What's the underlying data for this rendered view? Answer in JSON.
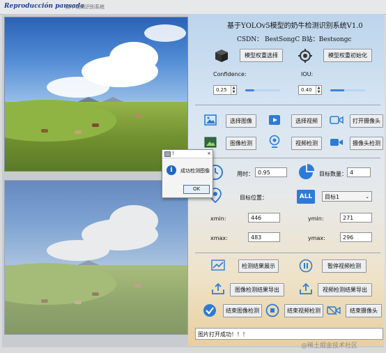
{
  "window": {
    "title_overlay": "Reproducción pausada",
    "app_name": "奶牛检测识别系统"
  },
  "header": {
    "title": "基于YOLOv5模型的奶牛检测识别系统V1.0",
    "subtitle": "CSDN：  BestSongC   B站：Bestsongc"
  },
  "model": {
    "select_label": "模型权重选择",
    "init_label": "模型权重初始化",
    "confidence_label": "Confidence:",
    "confidence_value": "0.25",
    "confidence_level": 0.25,
    "iou_label": "IOU:",
    "iou_value": "0.40",
    "iou_level": 0.4
  },
  "actions": {
    "select_image": "选择图像",
    "select_video": "选择视频",
    "open_camera": "打开摄像头",
    "image_detect": "图像检测",
    "video_detect": "视频检测",
    "camera_detect": "摄像头检测"
  },
  "results": {
    "time_label": "用时：",
    "time_value": "0.95",
    "count_label": "目标数量：",
    "count_value": "4",
    "position_label": "目标位置：",
    "target_select": "目标1",
    "xmin_label": "xmin:",
    "xmin_value": "446",
    "ymin_label": "ymin:",
    "ymin_value": "271",
    "xmax_label": "xmax:",
    "xmax_value": "483",
    "ymax_label": "ymax:",
    "ymax_value": "296"
  },
  "bottom_actions": {
    "show_results": "检测结果展示",
    "pause_video": "暂停视频检测",
    "export_image": "图像检测结果导出",
    "export_video": "视频检测结果导出",
    "end_image": "结束图像检测",
    "end_video": "结束视频检测",
    "end_camera": "结束摄像头"
  },
  "status_text": "图片打开成功！！！",
  "watermark": "@稀土掘金技术社区",
  "dialog": {
    "title": "!",
    "close": "×",
    "message": "成功检测图像",
    "ok_label": "OK"
  },
  "colors": {
    "accent": "#1f67c4",
    "slider": "#8dbbe8",
    "title_overlay": "#1d3e9e"
  }
}
